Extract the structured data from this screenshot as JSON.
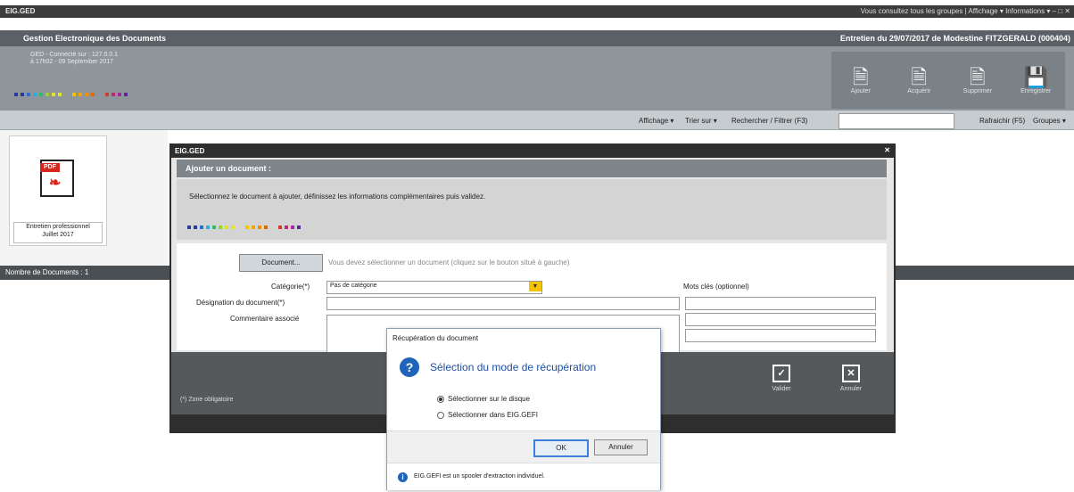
{
  "app": {
    "title": "EIG.GED",
    "menu": "Vous consultez tous les groupes | Affichage ▾ Informations ▾ – □ ✕"
  },
  "header": {
    "left_title": "Gestion Electronique des Documents",
    "right_title": "Entretien du 29/07/2017 de Modestine FITZGERALD (000404)",
    "connection_line1": "GED - Connecté sur : 127.0.0.1",
    "connection_line2": "à 17h02 - 09 September 2017"
  },
  "toolbar": {
    "buttons": [
      {
        "label": "Ajouter",
        "icon": "add-document-icon"
      },
      {
        "label": "Acquérir",
        "icon": "acquire-document-icon"
      },
      {
        "label": "Supprimer",
        "icon": "delete-document-icon"
      },
      {
        "label": "Enregistrer",
        "icon": "save-icon"
      }
    ]
  },
  "filterbar": {
    "affichage": "Affichage ▾",
    "trier": "Trier sur ▾",
    "rechercher": "Rechercher / Filtrer (F3)",
    "rafraichir": "Rafraichir (F5)",
    "groupes": "Groupes ▾"
  },
  "document": {
    "caption_line1": "Entretien professionnel",
    "caption_line2": "Juillet 2017"
  },
  "status": {
    "count": "Nombre de Documents : 1"
  },
  "dialog": {
    "title": "EIG.GED",
    "close": "✕",
    "heading": "Ajouter un document :",
    "intro": "Sélectionnez le document à ajouter, définissez les informations complémentaires puis validez.",
    "document_button": "Document...",
    "document_hint": "Vous devez sélectionner un document (cliquez sur le bouton situé à gauche)",
    "category_label": "Catégorie(*)",
    "category_value": "Pas de catégorie",
    "designation_label": "Désignation du document(*)",
    "comment_label": "Commentaire associé",
    "keywords_label": "Mots clés (optionnel)",
    "required_note": "(*) Zone obligatoire",
    "validate_label": "Valider",
    "cancel_label": "Annuler"
  },
  "msgbox": {
    "title": "Récupération du document",
    "main": "Sélection du mode de récupération",
    "option1": "Sélectionner sur le disque",
    "option2": "Sélectionner dans EIG.GEFI",
    "ok": "OK",
    "cancel": "Annuler",
    "info": "EIG.GEFI est un spooler d'extraction individuel."
  },
  "colors": {
    "dots": [
      "#2b3b9c",
      "#2b3b9c",
      "#2a6fd6",
      "#2bb0d8",
      "#2bbf6a",
      "#9ad12b",
      "#e3e32b",
      "#e3e32b",
      "#f3c400",
      "#f3a400",
      "#f39000",
      "#e06a00",
      "#d43a2a",
      "#c02a6a",
      "#a02aa0",
      "#5a2a9a"
    ],
    "pdf_red": "#d9261c",
    "accent_blue": "#1f64b8"
  }
}
